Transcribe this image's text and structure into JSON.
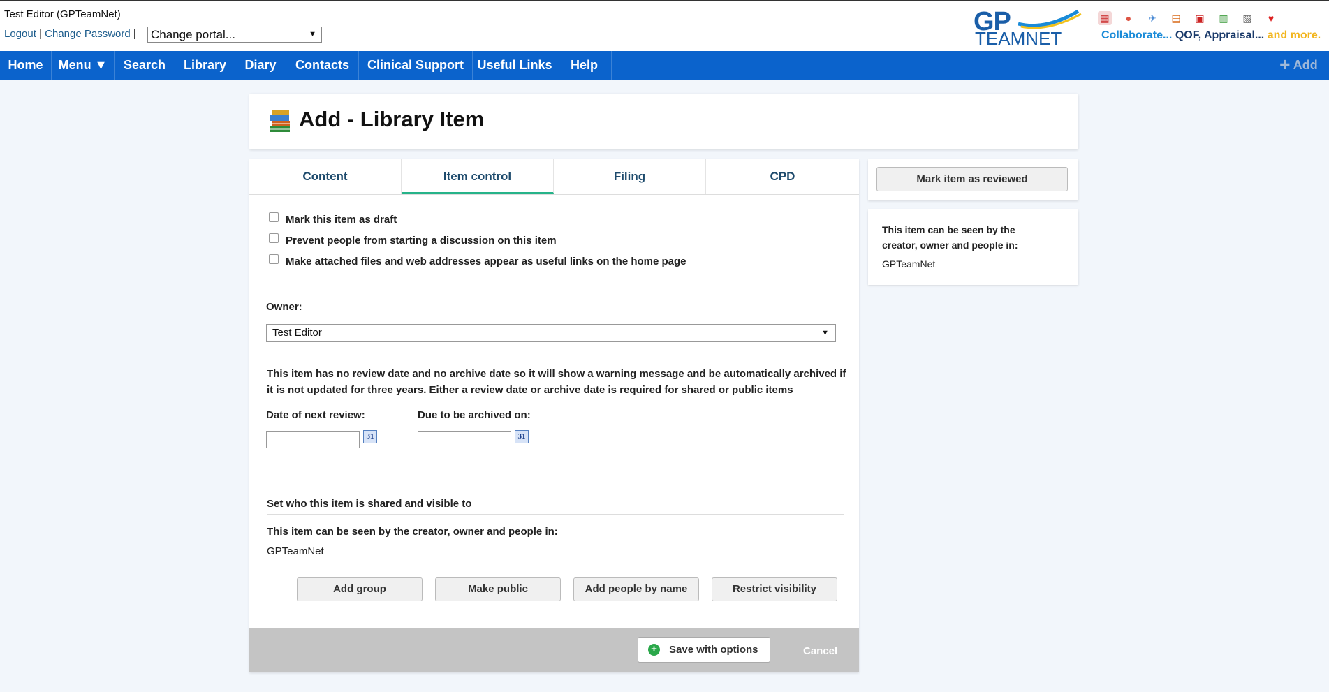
{
  "header": {
    "user": "Test Editor (GPTeamNet)",
    "logout": "Logout",
    "separator": "|",
    "change_password": "Change Password",
    "portal_select": "Change portal...",
    "logo_gp": "GP",
    "logo_team": "TEAMNET",
    "tagline_collaborate": "Collaborate...",
    "tagline_qof": "QOF, Appraisal...",
    "tagline_more": "and more.",
    "app_icons": [
      "calendar-icon",
      "people-icon",
      "bird-icon",
      "books-icon",
      "pdf-icon",
      "chart-icon",
      "book-icon",
      "heart-icon"
    ]
  },
  "nav": {
    "items": [
      "Home",
      "Menu ▼",
      "Search",
      "Library",
      "Diary",
      "Contacts",
      "Clinical Support",
      "Useful Links",
      "Help"
    ],
    "add": "✚ Add"
  },
  "page": {
    "title": "Add - Library Item"
  },
  "tabs": [
    "Content",
    "Item control",
    "Filing",
    "CPD"
  ],
  "active_tab": "Item control",
  "checkboxes": [
    {
      "label": "Mark this item as draft",
      "checked": false
    },
    {
      "label": "Prevent people from starting a discussion on this item",
      "checked": false
    },
    {
      "label": "Make attached files and web addresses appear as useful links on the home page",
      "checked": false
    }
  ],
  "owner": {
    "label": "Owner:",
    "value": "Test Editor"
  },
  "warning": "This item has no review date and no archive date so it will show a warning message and be automatically archived if it is not updated for three years. Either a review date or archive date is required for shared or public items",
  "dates": {
    "review_label": "Date of next review:",
    "archive_label": "Due to be archived on:",
    "review_value": "",
    "archive_value": "",
    "calendar_glyph": "31"
  },
  "sharing": {
    "heading": "Set who this item is shared and visible to",
    "visibility_text": "This item can be seen by the creator, owner and people in:",
    "group": "GPTeamNet",
    "buttons": [
      "Add group",
      "Make public",
      "Add people by name",
      "Restrict visibility"
    ]
  },
  "footer": {
    "save": "Save with options",
    "cancel": "Cancel"
  },
  "side": {
    "reviewed_button": "Mark item as reviewed",
    "visibility_text": "This item can be seen by the creator, owner and people in:",
    "group": "GPTeamNet"
  },
  "colors": {
    "nav_bg": "#0b63cc",
    "tab_active_underline": "#26b389",
    "page_bg": "#f2f6fb",
    "footer_bar": "#c4c4c4"
  }
}
